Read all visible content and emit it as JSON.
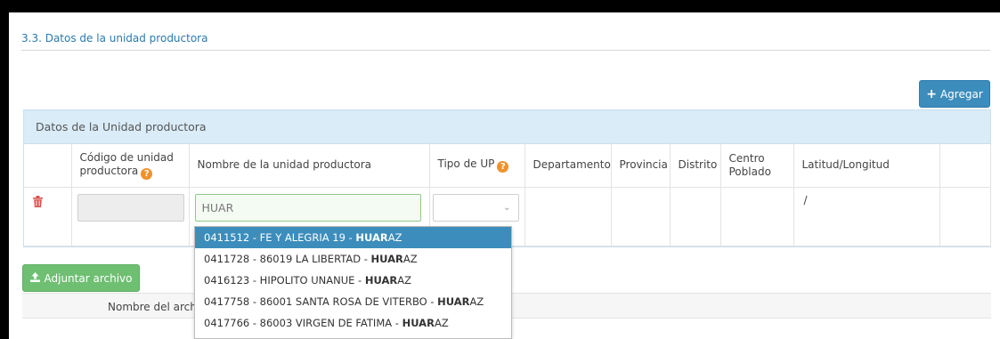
{
  "section": {
    "title": "3.3. Datos de la unidad productora"
  },
  "toolbar": {
    "add_label": "Agregar",
    "add_icon": "plus-icon"
  },
  "panel": {
    "title": "Datos de la Unidad productora"
  },
  "table": {
    "headers": {
      "code_line1": "Código de unidad",
      "code_line2": "productora",
      "name": "Nombre de la unidad productora",
      "type": "Tipo de UP",
      "departamento": "Departamento",
      "provincia": "Provincia",
      "distrito": "Distrito",
      "centro_line1": "Centro",
      "centro_line2": "Poblado",
      "latlng": "Latitud/Longitud"
    },
    "row": {
      "code_value": "",
      "name_value": "HUAR",
      "type_value": "",
      "latlng": "/"
    }
  },
  "autocomplete": {
    "items": [
      {
        "prefix": "0411512 - FE Y ALEGRIA 19 - ",
        "match": "HUAR",
        "suffix": "AZ"
      },
      {
        "prefix": "0411728 - 86019 LA LIBERTAD - ",
        "match": "HUAR",
        "suffix": "AZ"
      },
      {
        "prefix": "0416123 - HIPOLITO UNANUE - ",
        "match": "HUAR",
        "suffix": "AZ"
      },
      {
        "prefix": "0417758 - 86001 SANTA ROSA DE VITERBO - ",
        "match": "HUAR",
        "suffix": "AZ"
      },
      {
        "prefix": "0417766 - 86003 VIRGEN DE FATIMA - ",
        "match": "HUAR",
        "suffix": "AZ"
      }
    ]
  },
  "attach": {
    "label": "Adjuntar archivo",
    "icon": "upload-icon"
  },
  "files": {
    "column_label": "Nombre del archi"
  },
  "colors": {
    "primary": "#3c8dbc",
    "success": "#6fbf73",
    "warning": "#f0922c",
    "danger": "#d9534f",
    "panel_header": "#d9ecf7"
  }
}
